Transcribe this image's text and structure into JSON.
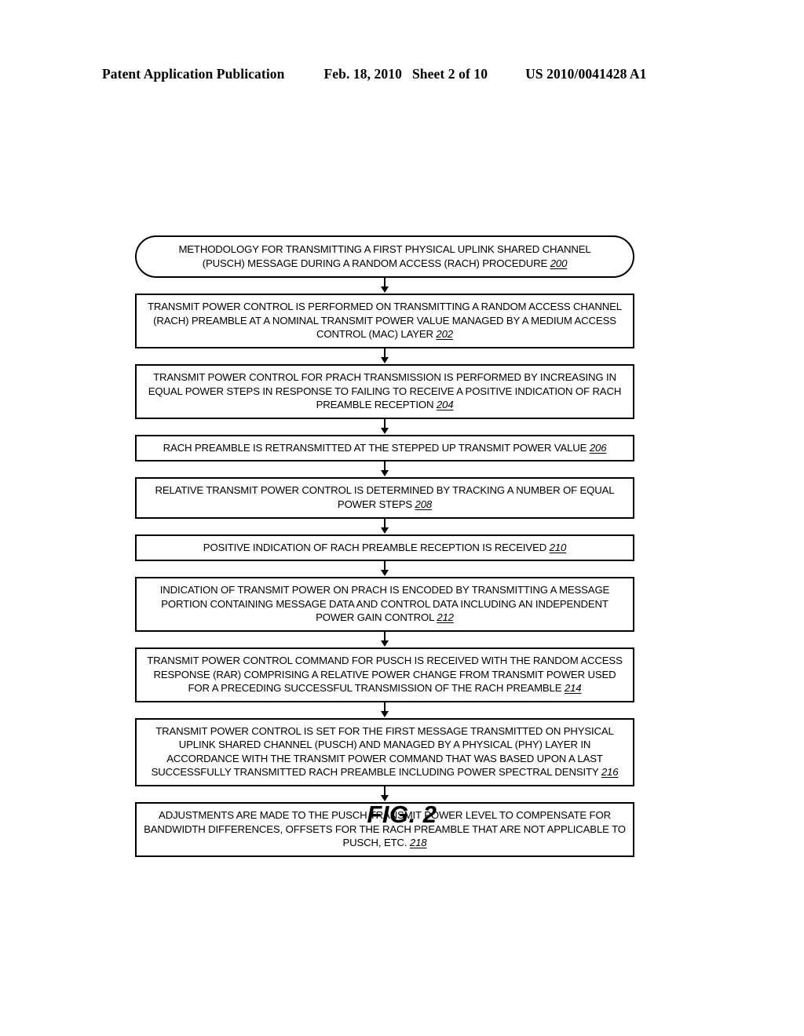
{
  "header": {
    "publication": "Patent Application Publication",
    "date": "Feb. 18, 2010",
    "sheet": "Sheet 2 of 10",
    "patent_number": "US 2010/0041428 A1"
  },
  "figure": {
    "caption": "FIG. 2",
    "type": "flowchart"
  },
  "flowchart": {
    "nodes": [
      {
        "id": "200",
        "shape": "terminator",
        "text": "METHODOLOGY FOR TRANSMITTING A FIRST PHYSICAL UPLINK SHARED CHANNEL (PUSCH) MESSAGE DURING A RANDOM ACCESS (RACH) PROCEDURE ",
        "ref": "200"
      },
      {
        "id": "202",
        "shape": "rect",
        "text": "TRANSMIT POWER CONTROL IS PERFORMED ON TRANSMITTING A RANDOM ACCESS CHANNEL (RACH) PREAMBLE AT A NOMINAL TRANSMIT POWER VALUE MANAGED BY A MEDIUM ACCESS CONTROL (MAC) LAYER ",
        "ref": "202"
      },
      {
        "id": "204",
        "shape": "rect",
        "text": "TRANSMIT POWER CONTROL FOR PRACH TRANSMISSION IS PERFORMED BY INCREASING IN EQUAL POWER STEPS IN RESPONSE TO FAILING TO RECEIVE A POSITIVE INDICATION OF RACH PREAMBLE RECEPTION  ",
        "ref": "204"
      },
      {
        "id": "206",
        "shape": "rect",
        "text": "RACH PREAMBLE IS RETRANSMITTED AT THE STEPPED UP TRANSMIT POWER VALUE ",
        "ref": "206"
      },
      {
        "id": "208",
        "shape": "rect",
        "text": "RELATIVE TRANSMIT POWER CONTROL IS DETERMINED BY TRACKING A NUMBER OF EQUAL POWER STEPS ",
        "ref": "208"
      },
      {
        "id": "210",
        "shape": "rect",
        "text": "POSITIVE INDICATION OF RACH PREAMBLE RECEPTION IS RECEIVED ",
        "ref": "210"
      },
      {
        "id": "212",
        "shape": "rect",
        "text": "INDICATION OF TRANSMIT POWER ON PRACH IS ENCODED BY TRANSMITTING A MESSAGE PORTION CONTAINING MESSAGE DATA AND CONTROL DATA INCLUDING AN INDEPENDENT POWER GAIN CONTROL ",
        "ref": "212"
      },
      {
        "id": "214",
        "shape": "rect",
        "text": "TRANSMIT POWER CONTROL COMMAND FOR PUSCH IS RECEIVED WITH THE RANDOM ACCESS RESPONSE (RAR) COMPRISING A RELATIVE POWER CHANGE FROM TRANSMIT POWER USED FOR A PRECEDING SUCCESSFUL TRANSMISSION OF THE RACH PREAMBLE ",
        "ref": "214"
      },
      {
        "id": "216",
        "shape": "rect",
        "text": "TRANSMIT POWER CONTROL IS SET FOR THE FIRST MESSAGE TRANSMITTED ON PHYSICAL UPLINK SHARED CHANNEL (PUSCH) AND MANAGED BY A PHYSICAL (PHY) LAYER IN ACCORDANCE WITH THE TRANSMIT POWER COMMAND THAT WAS BASED UPON A LAST SUCCESSFULLY TRANSMITTED RACH PREAMBLE INCLUDING POWER SPECTRAL DENSITY ",
        "ref": "216"
      },
      {
        "id": "218",
        "shape": "rect",
        "text": "ADJUSTMENTS ARE MADE TO THE PUSCH TRANSMIT POWER LEVEL TO COMPENSATE FOR BANDWIDTH DIFFERENCES, OFFSETS FOR THE RACH PREAMBLE THAT ARE NOT APPLICABLE TO PUSCH, ETC. ",
        "ref": "218"
      }
    ]
  }
}
